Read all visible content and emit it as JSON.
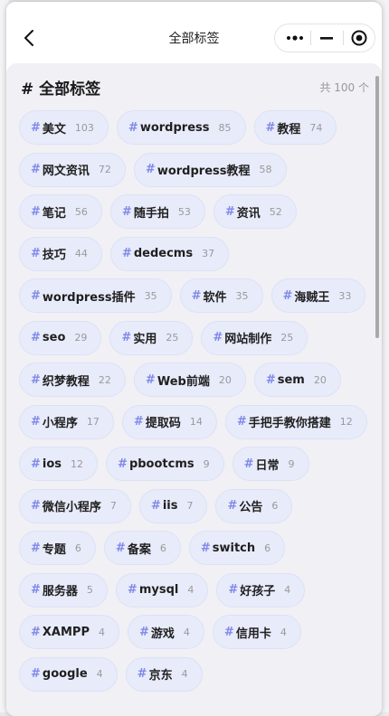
{
  "nav": {
    "title": "全部标签"
  },
  "header": {
    "title": "全部标签",
    "hash": "#",
    "total": "共 100 个"
  },
  "tags": [
    {
      "name": "美文",
      "count": "103"
    },
    {
      "name": "wordpress",
      "count": "85"
    },
    {
      "name": "教程",
      "count": "74"
    },
    {
      "name": "网文资讯",
      "count": "72"
    },
    {
      "name": "wordpress教程",
      "count": "58"
    },
    {
      "name": "笔记",
      "count": "56"
    },
    {
      "name": "随手拍",
      "count": "53"
    },
    {
      "name": "资讯",
      "count": "52"
    },
    {
      "name": "技巧",
      "count": "44"
    },
    {
      "name": "dedecms",
      "count": "37"
    },
    {
      "name": "wordpress插件",
      "count": "35"
    },
    {
      "name": "软件",
      "count": "35"
    },
    {
      "name": "海贼王",
      "count": "33"
    },
    {
      "name": "seo",
      "count": "29"
    },
    {
      "name": "实用",
      "count": "25"
    },
    {
      "name": "网站制作",
      "count": "25"
    },
    {
      "name": "织梦教程",
      "count": "22"
    },
    {
      "name": "Web前端",
      "count": "20"
    },
    {
      "name": "sem",
      "count": "20"
    },
    {
      "name": "小程序",
      "count": "17"
    },
    {
      "name": "提取码",
      "count": "14"
    },
    {
      "name": "手把手教你搭建",
      "count": "12"
    },
    {
      "name": "ios",
      "count": "12"
    },
    {
      "name": "pbootcms",
      "count": "9"
    },
    {
      "name": "日常",
      "count": "9"
    },
    {
      "name": "微信小程序",
      "count": "7"
    },
    {
      "name": "iis",
      "count": "7"
    },
    {
      "name": "公告",
      "count": "6"
    },
    {
      "name": "专题",
      "count": "6"
    },
    {
      "name": "备案",
      "count": "6"
    },
    {
      "name": "switch",
      "count": "6"
    },
    {
      "name": "服务器",
      "count": "5"
    },
    {
      "name": "mysql",
      "count": "4"
    },
    {
      "name": "好孩子",
      "count": "4"
    },
    {
      "name": "XAMPP",
      "count": "4"
    },
    {
      "name": "游戏",
      "count": "4"
    },
    {
      "name": "信用卡",
      "count": "4"
    },
    {
      "name": "google",
      "count": "4"
    },
    {
      "name": "京东",
      "count": "4"
    }
  ],
  "colors": {
    "accent": "#7f89e8",
    "tag_bg": "#e8ebfa",
    "panel_bg": "#f0f0f5"
  },
  "icons": {
    "back": "chevron-left-icon",
    "more": "more-dots-icon",
    "minimize": "minimize-icon",
    "close": "target-circle-icon"
  }
}
